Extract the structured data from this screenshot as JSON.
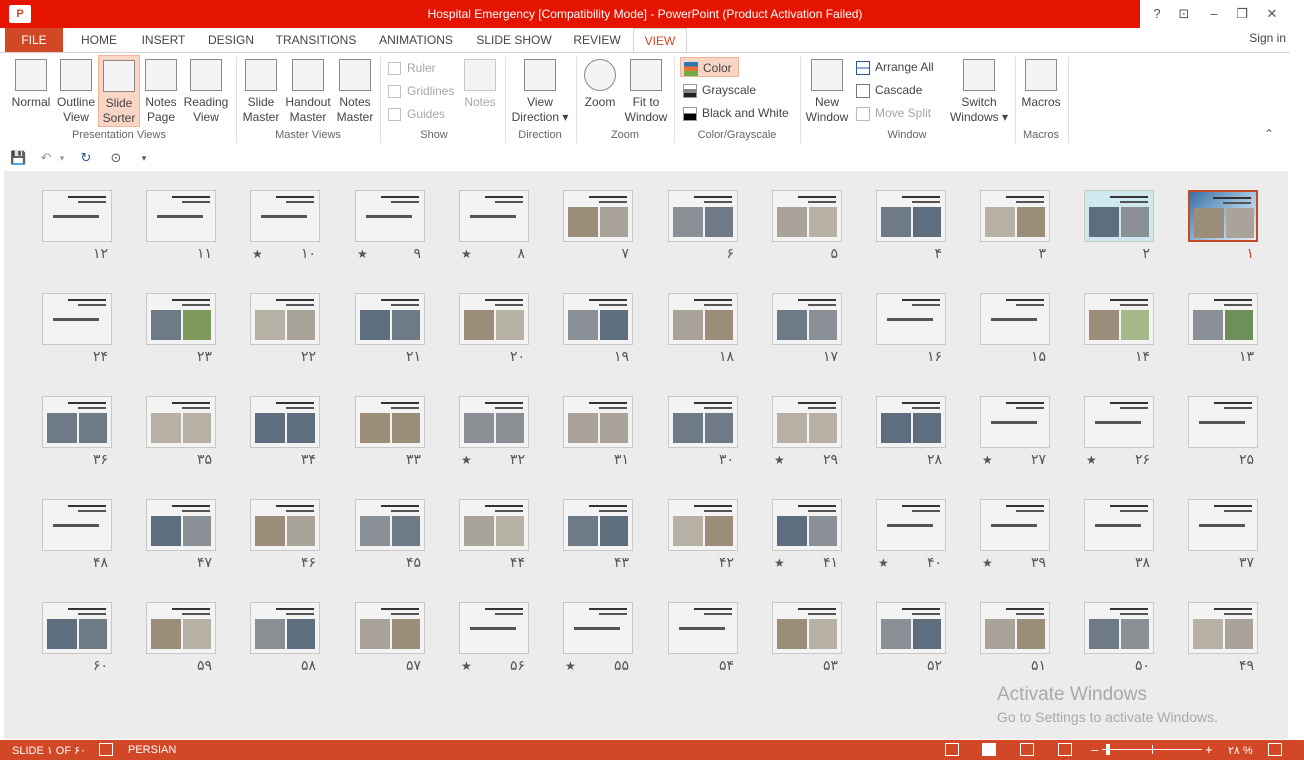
{
  "window": {
    "title": "Hospital Emergency [Compatibility Mode] - PowerPoint (Product Activation Failed)",
    "app_icon_label": "P",
    "help": "?",
    "restore_ribbon": "⊡",
    "minimize": "–",
    "maximize": "❐",
    "close": "✕"
  },
  "tabs": [
    "FILE",
    "HOME",
    "INSERT",
    "DESIGN",
    "TRANSITIONS",
    "ANIMATIONS",
    "SLIDE SHOW",
    "REVIEW",
    "VIEW"
  ],
  "active_tab": "VIEW",
  "signin": "Sign in",
  "ribbon": {
    "presentation_views": {
      "label": "Presentation Views",
      "normal": "Normal",
      "outline": "Outline\nView",
      "slide_sorter": "Slide\nSorter",
      "notes_page": "Notes\nPage",
      "reading_view": "Reading\nView"
    },
    "master_views": {
      "label": "Master Views",
      "slide_master": "Slide\nMaster",
      "handout_master": "Handout\nMaster",
      "notes_master": "Notes\nMaster"
    },
    "show": {
      "label": "Show",
      "ruler": "Ruler",
      "gridlines": "Gridlines",
      "guides": "Guides",
      "notes": "Notes"
    },
    "direction": {
      "label": "Direction",
      "view_direction": "View\nDirection ▾"
    },
    "zoom": {
      "label": "Zoom",
      "zoom": "Zoom",
      "fit_to_window": "Fit to\nWindow"
    },
    "color_grayscale": {
      "label": "Color/Grayscale",
      "color": "Color",
      "grayscale": "Grayscale",
      "black_and_white": "Black and White"
    },
    "window": {
      "label": "Window",
      "new_window": "New\nWindow",
      "arrange_all": "Arrange All",
      "cascade": "Cascade",
      "move_split": "Move Split",
      "switch_windows": "Switch\nWindows ▾"
    },
    "macros": {
      "label": "Macros",
      "macros": "Macros"
    },
    "collapse": "⌃"
  },
  "qat": {
    "save": "💾",
    "undo": "↶",
    "undo_drop": "▾",
    "redo": "↻",
    "present": "⊙",
    "customize": "▾"
  },
  "slides": {
    "row1": [
      "۱۲",
      "۱۱",
      "۱۰",
      "۹",
      "۸",
      "۷",
      "۶",
      "۵",
      "۴",
      "۳",
      "۲",
      "۱"
    ],
    "row2": [
      "۲۴",
      "۲۳",
      "۲۲",
      "۲۱",
      "۲۰",
      "۱۹",
      "۱۸",
      "۱۷",
      "۱۶",
      "۱۵",
      "۱۴",
      "۱۳"
    ],
    "row3": [
      "۳۶",
      "۳۵",
      "۳۴",
      "۳۳",
      "۳۲",
      "۳۱",
      "۳۰",
      "۲۹",
      "۲۸",
      "۲۷",
      "۲۶",
      "۲۵"
    ],
    "row4": [
      "۴۸",
      "۴۷",
      "۴۶",
      "۴۵",
      "۴۴",
      "۴۳",
      "۴۲",
      "۴۱",
      "۴۰",
      "۳۹",
      "۳۸",
      "۳۷"
    ],
    "row5": [
      "۶۰",
      "۵۹",
      "۵۸",
      "۵۷",
      "۵۶",
      "۵۵",
      "۵۴",
      "۵۳",
      "۵۲",
      "۵۱",
      "۵۰",
      "۴۹"
    ],
    "star_symbol": "★"
  },
  "watermark": {
    "line1": "Activate Windows",
    "line2": "Go to Settings to activate Windows."
  },
  "status": {
    "slide_count": "SLIDE ۱ OF ۶۰",
    "language": "PERSIAN",
    "zoom_level": "۲۸ %",
    "zoom_minus": "–",
    "zoom_plus": "+"
  }
}
